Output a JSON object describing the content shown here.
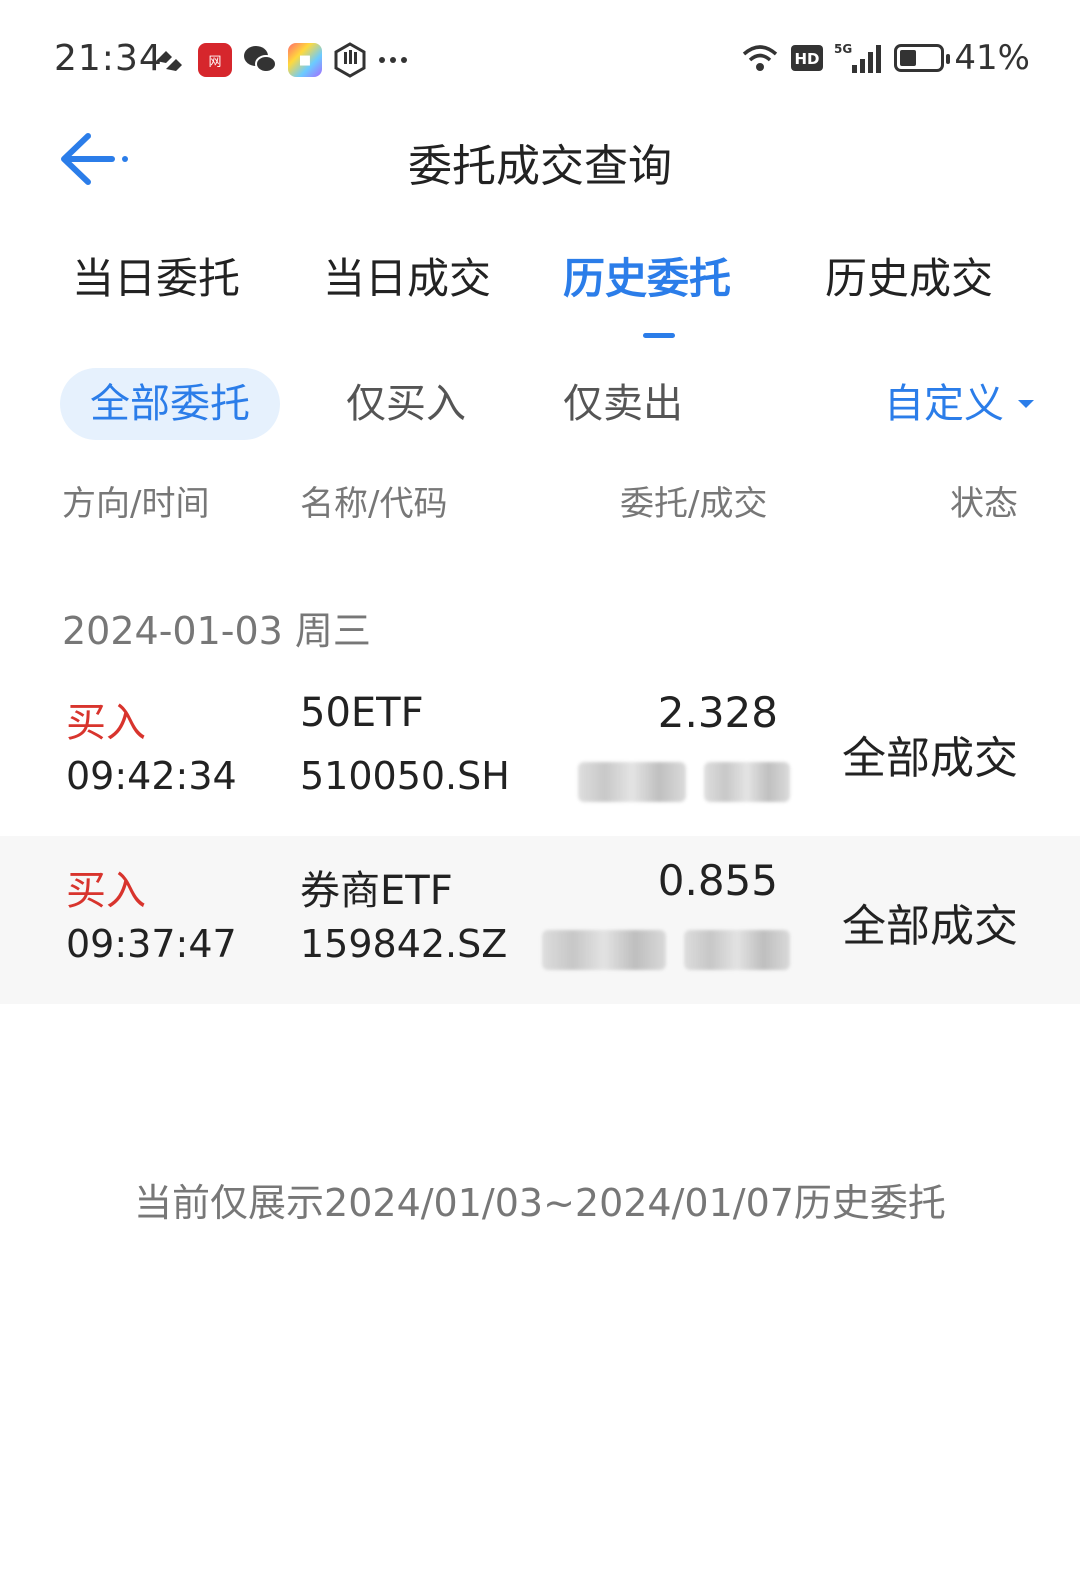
{
  "status_bar": {
    "time": "21:34",
    "battery_text": "41%",
    "battery_level": 0.41,
    "network_labels": [
      "HD",
      "5G"
    ],
    "left_icons": [
      "notification-icon",
      "netease-app-icon",
      "wechat-icon",
      "app-icon",
      "hand-icon",
      "more-dots-icon"
    ],
    "right_icons": [
      "wifi-icon",
      "hd-icon",
      "signal-5g-icon",
      "battery-icon"
    ]
  },
  "header": {
    "title": "委托成交查询",
    "back_icon": "back-arrow-icon"
  },
  "tabs": [
    {
      "label": "当日委托",
      "active": false
    },
    {
      "label": "当日成交",
      "active": false
    },
    {
      "label": "历史委托",
      "active": true
    },
    {
      "label": "历史成交",
      "active": false
    }
  ],
  "filters": {
    "items": [
      {
        "label": "全部委托",
        "active": true
      },
      {
        "label": "仅买入",
        "active": false
      },
      {
        "label": "仅卖出",
        "active": false
      }
    ],
    "custom_label": "自定义",
    "custom_icon": "caret-down-icon"
  },
  "columns": {
    "direction_time": "方向/时间",
    "name_code": "名称/代码",
    "order_deal": "委托/成交",
    "status": "状态"
  },
  "groups": [
    {
      "date": "2024-01-03 周三",
      "rows": [
        {
          "direction": "买入",
          "time": "09:42:34",
          "name": "50ETF",
          "code": "510050.SH",
          "price": "2.328",
          "status": "全部成交"
        },
        {
          "direction": "买入",
          "time": "09:37:47",
          "name": "券商ETF",
          "code": "159842.SZ",
          "price": "0.855",
          "status": "全部成交"
        }
      ]
    }
  ],
  "footer_note": "当前仅展示2024/01/03~2024/01/07历史委托",
  "colors": {
    "accent": "#2b7de9",
    "buy": "#d8342d",
    "muted": "#777777",
    "active_pill_bg": "#e6f1fd"
  }
}
